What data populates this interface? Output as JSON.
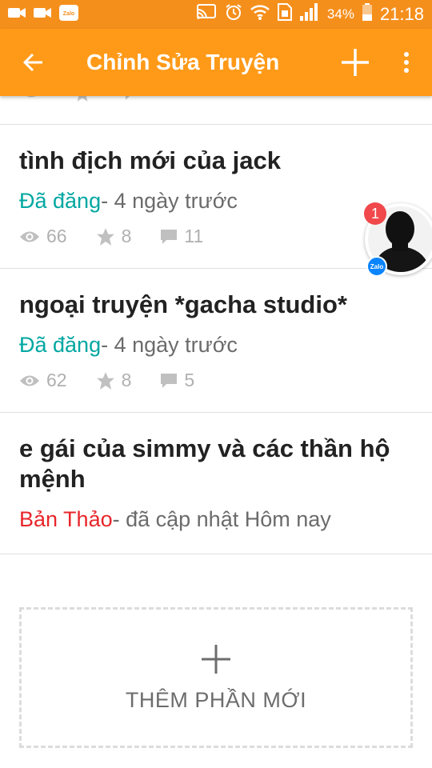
{
  "status_bar": {
    "battery_percent": "34%",
    "time": "21:18",
    "zalo_label": "Zalo"
  },
  "app_bar": {
    "title": "Chỉnh Sửa Truyện"
  },
  "parts": [
    {
      "title": "tình địch mới của jack",
      "status": "Đã đăng",
      "meta": "- 4 ngày trước",
      "views": "66",
      "votes": "8",
      "comments": "11"
    },
    {
      "title": "ngoại truyện *gacha studio*",
      "status": "Đã đăng",
      "meta": "- 4 ngày trước",
      "views": "62",
      "votes": "8",
      "comments": "5"
    },
    {
      "title": "e gái của simmy và các thần hộ mệnh",
      "status": "Bản Thảo",
      "meta": "- đã cập nhật Hôm nay"
    }
  ],
  "add_part": {
    "label": "THÊM PHẦN MỚI"
  },
  "chat_head": {
    "badge_count": "1",
    "app_label": "Zalo"
  },
  "colors": {
    "app_bar": "#ff9a19",
    "published": "#00a7a1",
    "draft": "#e8262b"
  }
}
